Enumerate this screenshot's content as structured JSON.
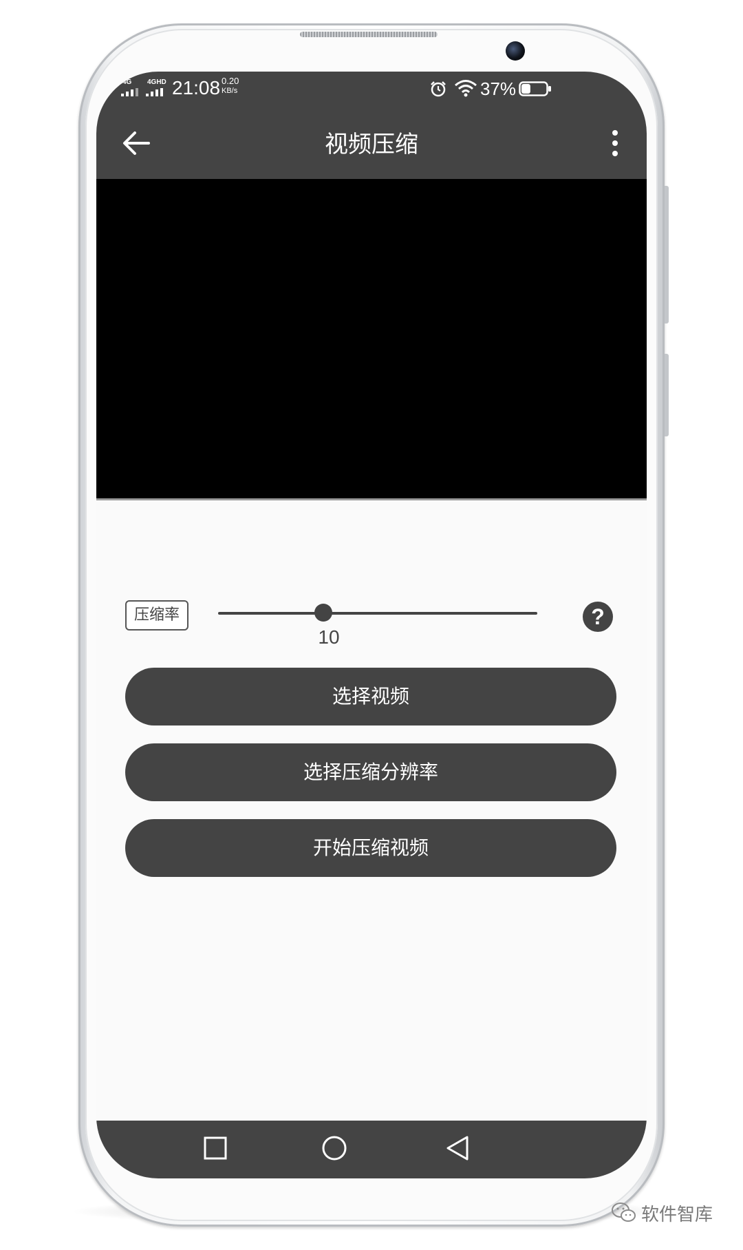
{
  "statusbar": {
    "signal1_label": "4G",
    "signal2_label": "4GHD",
    "time": "21:08",
    "speed_value": "0.20",
    "speed_unit": "KB/s",
    "battery_percent": "37%",
    "battery_level": 0.37
  },
  "appbar": {
    "title": "视频压缩"
  },
  "compression": {
    "label": "压缩率",
    "slider_value": "10",
    "slider_fraction": 0.33,
    "help_symbol": "?"
  },
  "buttons": {
    "select_video": "选择视频",
    "select_resolution": "选择压缩分辨率",
    "start_compress": "开始压缩视频"
  },
  "watermark": {
    "text": "软件智库"
  },
  "colors": {
    "bar_background": "#444444",
    "screen_background": "#fafafa",
    "video_background": "#000000"
  },
  "icons": {
    "back": "arrow-left-icon",
    "menu": "more-vert-icon",
    "help": "help-icon",
    "alarm": "alarm-icon",
    "wifi": "wifi-icon",
    "battery": "battery-icon",
    "nav_recents": "square-icon",
    "nav_home": "circle-icon",
    "nav_back": "triangle-back-icon"
  }
}
